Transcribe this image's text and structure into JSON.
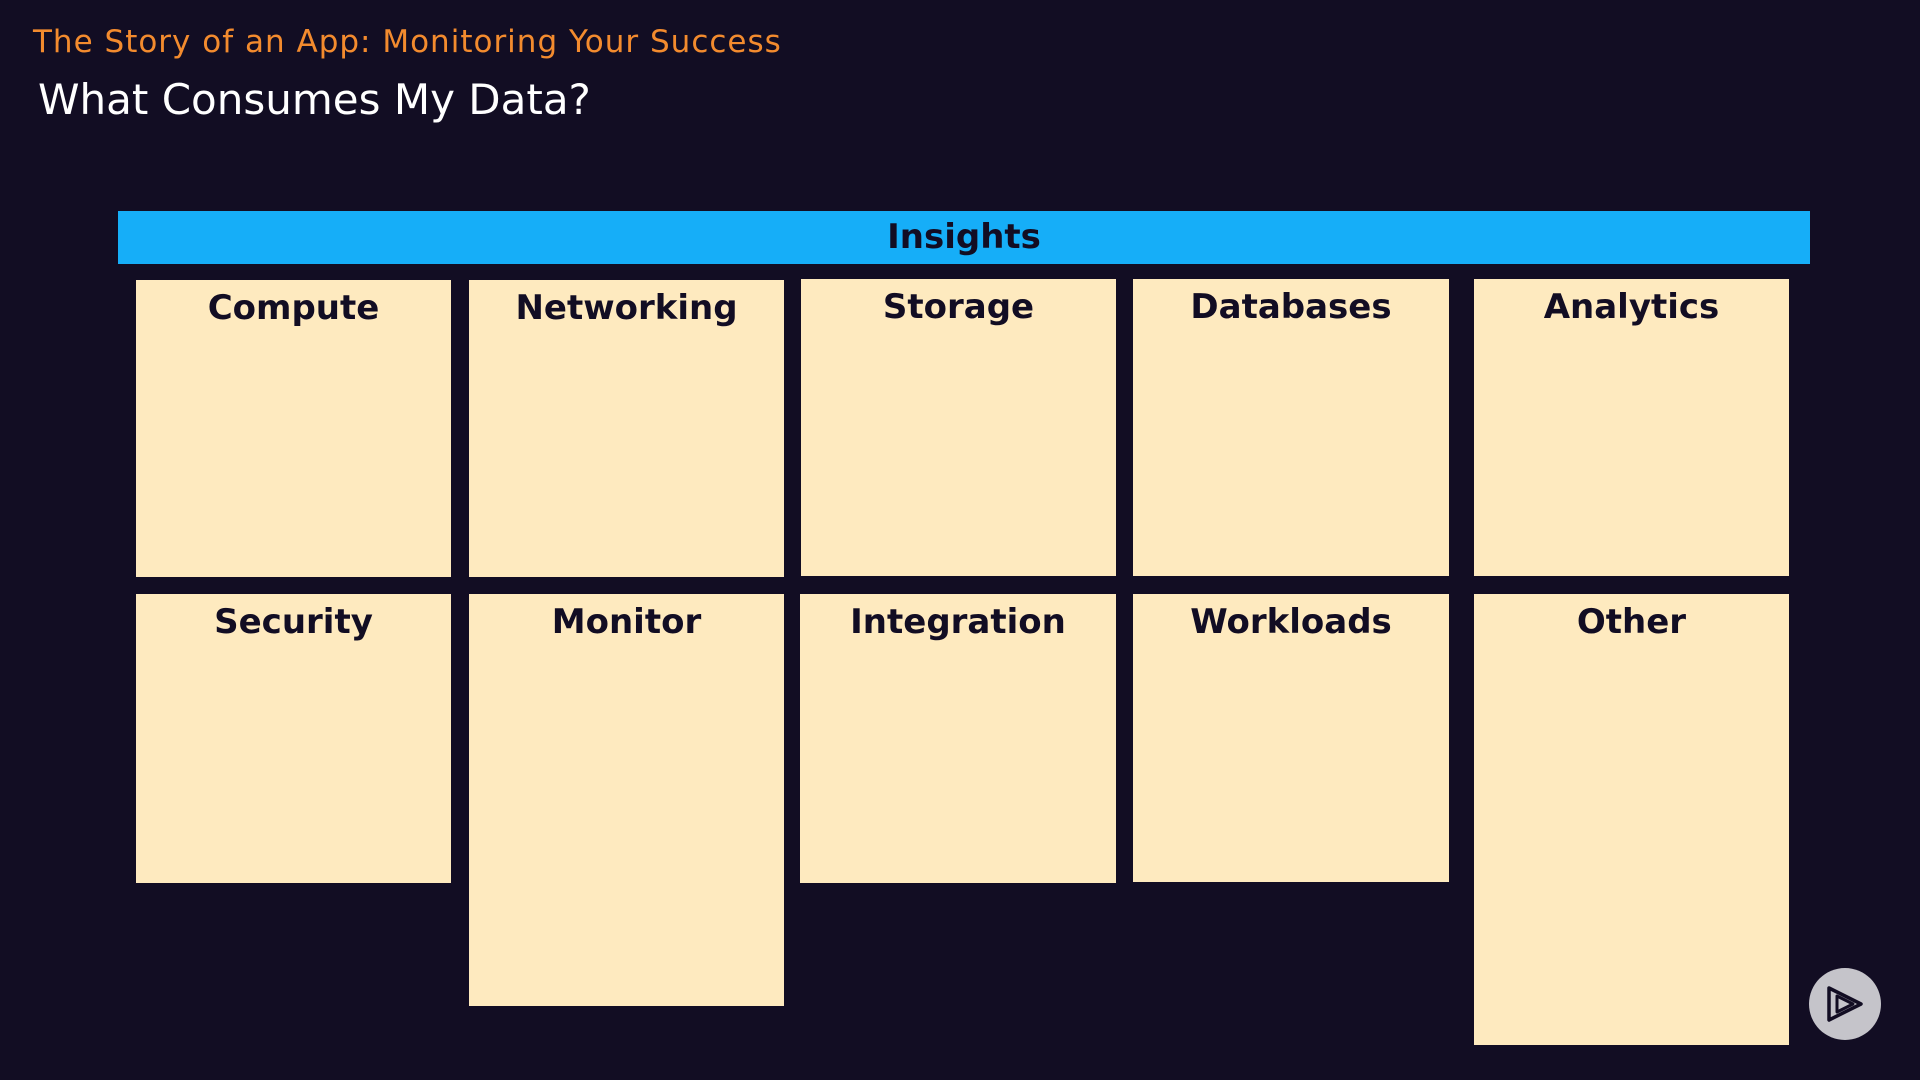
{
  "header": {
    "course_title": "The Story of an App: Monitoring Your Success",
    "slide_title": "What Consumes My Data?"
  },
  "banner": {
    "label": "Insights"
  },
  "notes": [
    {
      "label": "Compute"
    },
    {
      "label": "Networking"
    },
    {
      "label": "Storage"
    },
    {
      "label": "Databases"
    },
    {
      "label": "Analytics"
    },
    {
      "label": "Security"
    },
    {
      "label": "Monitor"
    },
    {
      "label": "Integration"
    },
    {
      "label": "Workloads"
    },
    {
      "label": "Other"
    }
  ],
  "colors": {
    "background": "#120d23",
    "course_title": "#f38b2e",
    "banner": "#16aef8",
    "note": "#feeabf"
  },
  "controls": {
    "play_icon": "play-logo-icon"
  }
}
